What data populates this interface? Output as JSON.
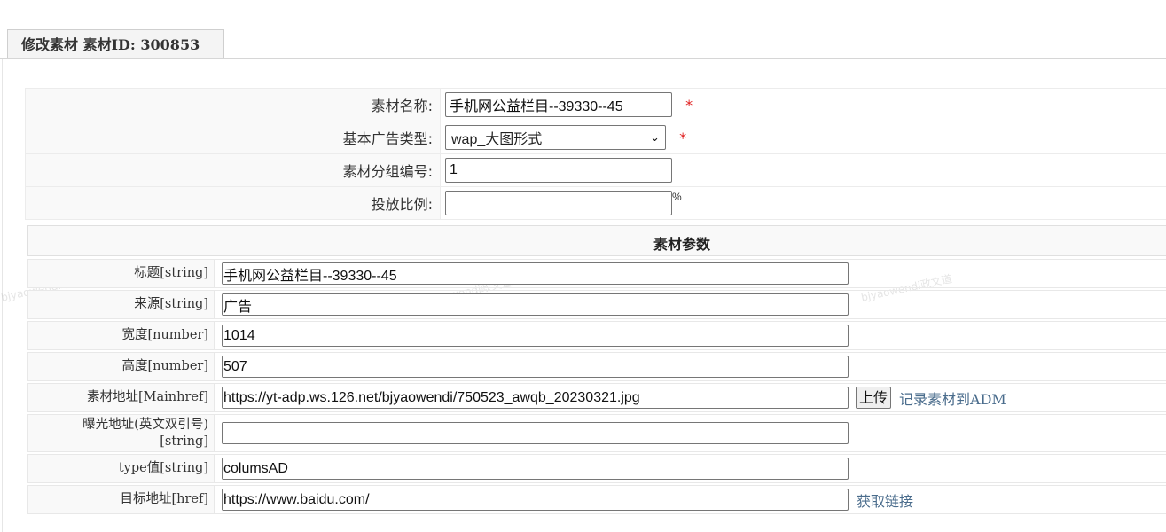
{
  "tab": {
    "title": "修改素材  素材ID: 300853"
  },
  "basic": {
    "name_label": "素材名称:",
    "name_value": "手机网公益栏目--39330--45",
    "type_label": "基本广告类型:",
    "type_value": "wap_大图形式",
    "group_label": "素材分组编号:",
    "group_value": "1",
    "ratio_label": "投放比例:",
    "ratio_value": "",
    "ratio_unit": "%",
    "required_mark": "*"
  },
  "section": {
    "title": "素材参数"
  },
  "params": {
    "title": {
      "label": "标题[string]",
      "value": "手机网公益栏目--39330--45"
    },
    "source": {
      "label": "来源[string]",
      "value": "广告"
    },
    "width": {
      "label": "宽度[number]",
      "value": "1014"
    },
    "height": {
      "label": "高度[number]",
      "value": "507"
    },
    "mainhref": {
      "label": "素材地址[Mainhref]",
      "value": "https://yt-adp.ws.126.net/bjyaowendi/750523_awqb_20230321.jpg",
      "upload_label": "上传",
      "record_label": "记录素材到ADM"
    },
    "exposure": {
      "label_line1": "曝光地址(英文双引号)",
      "label_line2": "[string]",
      "value": ""
    },
    "type": {
      "label": "type值[string]",
      "value": "columsAD"
    },
    "href": {
      "label": "目标地址[href]",
      "value": "https://www.baidu.com/",
      "get_link_label": "获取链接"
    }
  },
  "watermark": "bjyaowendi政文道"
}
